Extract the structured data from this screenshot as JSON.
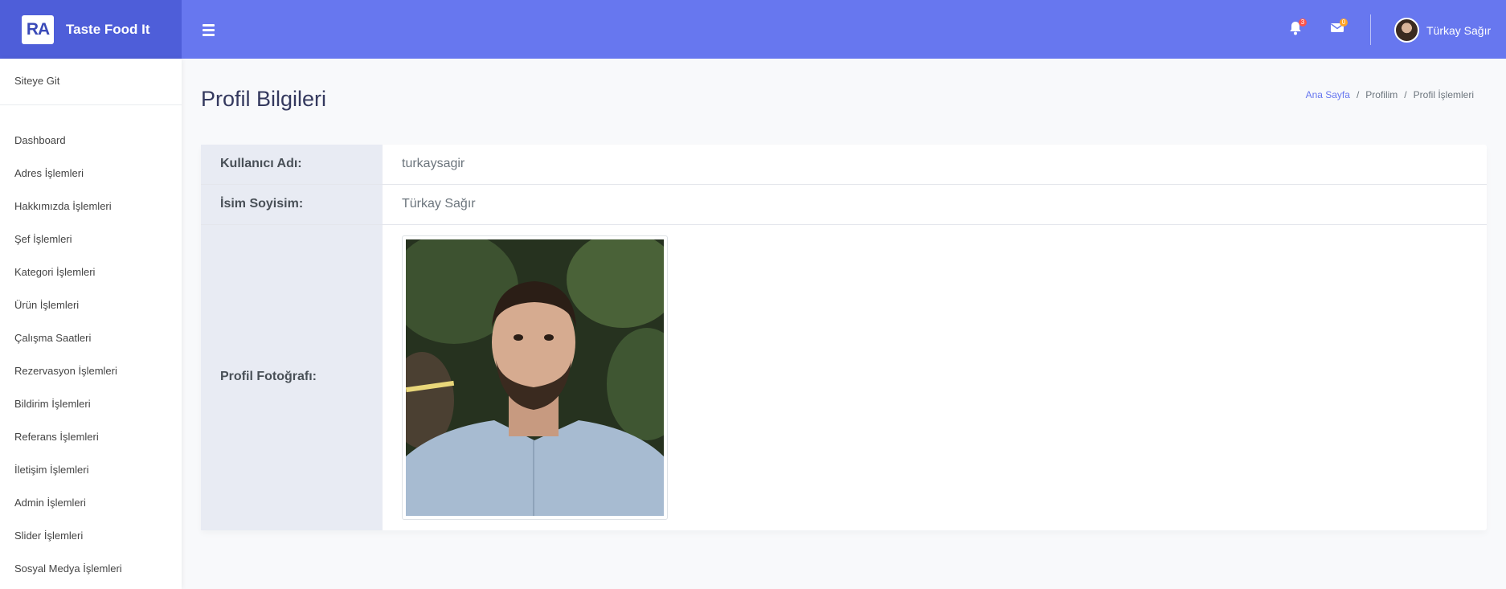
{
  "app": {
    "logo_text": "RA",
    "title": "Taste Food It"
  },
  "topbar": {
    "notifications_count": "3",
    "messages_count": "0",
    "user_name": "Türkay Sağır"
  },
  "sidebar": {
    "top_link": "Siteye Git",
    "items": [
      "Dashboard",
      "Adres İşlemleri",
      "Hakkımızda İşlemleri",
      "Şef İşlemleri",
      "Kategori İşlemleri",
      "Ürün İşlemleri",
      "Çalışma Saatleri",
      "Rezervasyon İşlemleri",
      "Bildirim İşlemleri",
      "Referans İşlemleri",
      "İletişim İşlemleri",
      "Admin İşlemleri",
      "Slider İşlemleri",
      "Sosyal Medya İşlemleri"
    ]
  },
  "page": {
    "title": "Profil Bilgileri",
    "breadcrumb": [
      "Ana Sayfa",
      "Profilim",
      "Profil İşlemleri"
    ]
  },
  "profile": {
    "username_label": "Kullanıcı Adı:",
    "username_value": "turkaysagir",
    "fullname_label": "İsim Soyisim:",
    "fullname_value": "Türkay Sağır",
    "photo_label": "Profil Fotoğrafı:"
  },
  "colors": {
    "accent": "#6777ef",
    "brand_dark": "#4e5ed9"
  }
}
